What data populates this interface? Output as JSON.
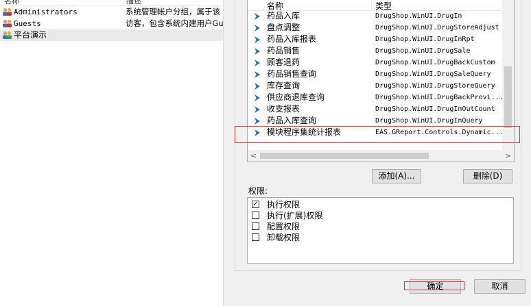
{
  "user_groups": {
    "columns": [
      "名称",
      "描述"
    ],
    "rows": [
      {
        "name": "Administrators",
        "description": "系统管理帐户分组，属于该"
      },
      {
        "name": "Guests",
        "description": "访客，包含系统内建用户Gu"
      },
      {
        "name": "平台演示",
        "description": ""
      }
    ]
  },
  "modules": {
    "columns": [
      "名称",
      "类型"
    ],
    "rows": [
      {
        "name": "药品入库",
        "type": "DrugShop.WinUI.DrugIn"
      },
      {
        "name": "盘点调整",
        "type": "DrugShop.WinUI.DrugStoreAdjust"
      },
      {
        "name": "药品入库报表",
        "type": "DrugShop.WinUI.DrugInRpt"
      },
      {
        "name": "药品销售",
        "type": "DrugShop.WinUI.DrugSale"
      },
      {
        "name": "顾客退药",
        "type": "DrugShop.WinUI.DrugBackCustom"
      },
      {
        "name": "药品销售查询",
        "type": "DrugShop.WinUI.DrugSaleQuery"
      },
      {
        "name": "库存查询",
        "type": "DrugShop.WinUI.DrugStoreQuery"
      },
      {
        "name": "供应商退库查询",
        "type": "DrugShop.WinUI.DrugBackProvi..."
      },
      {
        "name": "收支报表",
        "type": "DrugShop.WinUI.DrugInOutCount"
      },
      {
        "name": "药品入库查询",
        "type": "DrugShop.WinUI.DrugInQuery"
      },
      {
        "name": "模块程序集统计报表",
        "type": "EAS.GReport.Controls.Dynamic..."
      }
    ]
  },
  "buttons": {
    "add": "添加(A)...",
    "delete": "删除(D)",
    "ok": "确定",
    "cancel": "取消"
  },
  "permissions": {
    "label": "权限:",
    "items": [
      {
        "label": "执行权限",
        "checked": true
      },
      {
        "label": "执行(扩展)权限",
        "checked": false
      },
      {
        "label": "配置权限",
        "checked": false
      },
      {
        "label": "卸载权限",
        "checked": false
      }
    ]
  },
  "colors": {
    "highlight": "#d9363e",
    "arrow": "#2f6fb5"
  }
}
